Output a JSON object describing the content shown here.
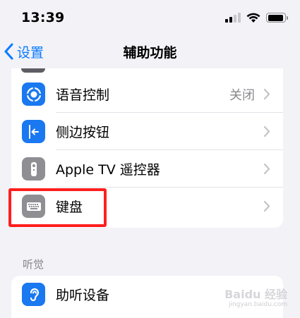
{
  "status_bar": {
    "time": "13:39"
  },
  "nav": {
    "back_label": "设置",
    "title": "辅助功能"
  },
  "group_main": {
    "items": [
      {
        "label": "语音控制",
        "value": "关闭",
        "icon": "voice-control-icon",
        "icon_color": "#1a78f0"
      },
      {
        "label": "侧边按钮",
        "value": "",
        "icon": "side-button-icon",
        "icon_color": "#1a78f0"
      },
      {
        "label": "Apple TV 遥控器",
        "value": "",
        "icon": "tv-remote-icon",
        "icon_color": "#8e8e93"
      },
      {
        "label": "键盘",
        "value": "",
        "icon": "keyboard-icon",
        "icon_color": "#8e8e93"
      }
    ]
  },
  "section_hearing": {
    "header": "听觉",
    "items": [
      {
        "label": "助听设备",
        "icon": "hearing-device-icon",
        "icon_color": "#1a78f0"
      }
    ]
  },
  "watermark": {
    "text": "Baidu 经验",
    "sub": "jingyan.baidu.com"
  },
  "colors": {
    "accent": "#0a7aff",
    "highlight": "#ff1e1e"
  }
}
